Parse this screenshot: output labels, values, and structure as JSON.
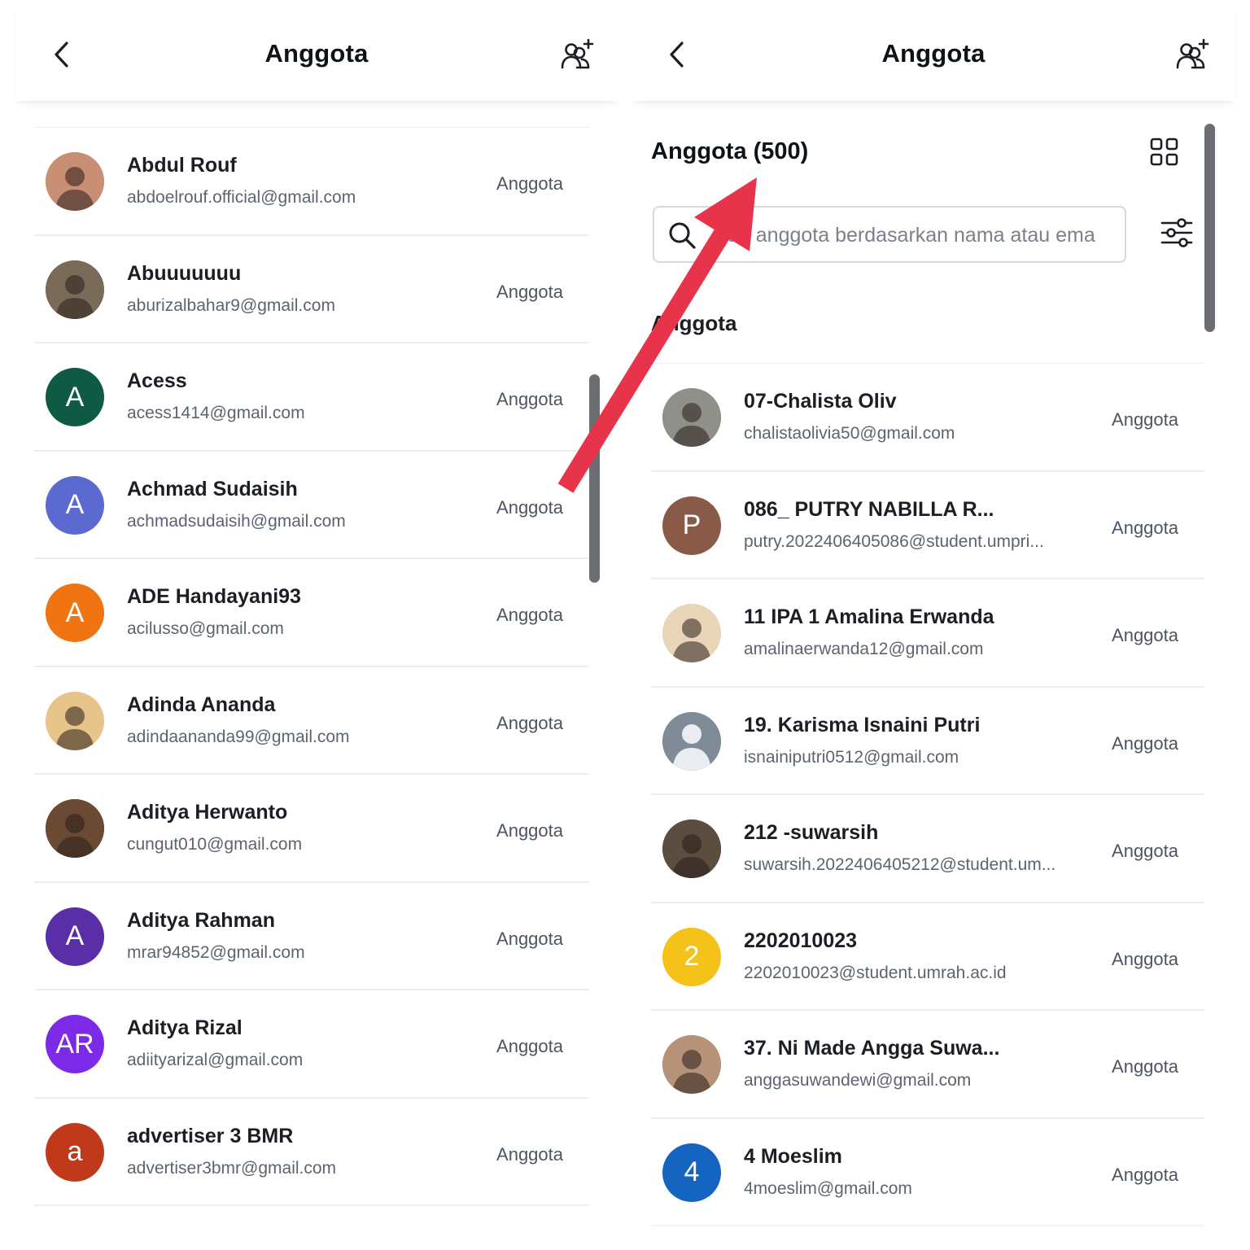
{
  "left": {
    "title": "Anggota",
    "members": [
      {
        "name": "Abdul Rouf",
        "email": "abdoelrouf.official@gmail.com",
        "role": "Anggota",
        "avatar": {
          "type": "photo",
          "color": "#c98f75"
        }
      },
      {
        "name": "Abuuuuuuu",
        "email": "aburizalbahar9@gmail.com",
        "role": "Anggota",
        "avatar": {
          "type": "photo",
          "color": "#7a6a58"
        }
      },
      {
        "name": "Acess",
        "email": "acess1414@gmail.com",
        "role": "Anggota",
        "avatar": {
          "type": "letter",
          "letter": "A",
          "color": "#0f5a45"
        }
      },
      {
        "name": "Achmad Sudaisih",
        "email": "achmadsudaisih@gmail.com",
        "role": "Anggota",
        "avatar": {
          "type": "letter",
          "letter": "A",
          "color": "#5c6ad0"
        }
      },
      {
        "name": "ADE Handayani93",
        "email": "acilusso@gmail.com",
        "role": "Anggota",
        "avatar": {
          "type": "letter",
          "letter": "A",
          "color": "#f07412"
        }
      },
      {
        "name": "Adinda Ananda",
        "email": "adindaananda99@gmail.com",
        "role": "Anggota",
        "avatar": {
          "type": "photo",
          "color": "#e7c48a"
        }
      },
      {
        "name": "Aditya Herwanto",
        "email": "cungut010@gmail.com",
        "role": "Anggota",
        "avatar": {
          "type": "photo",
          "color": "#6b4a34"
        }
      },
      {
        "name": "Aditya Rahman",
        "email": "mrar94852@gmail.com",
        "role": "Anggota",
        "avatar": {
          "type": "letter",
          "letter": "A",
          "color": "#5a2ea6"
        }
      },
      {
        "name": "Aditya Rizal",
        "email": "adiityarizal@gmail.com",
        "role": "Anggota",
        "avatar": {
          "type": "letter",
          "letter": "AR",
          "color": "#7d2ae8"
        }
      },
      {
        "name": "advertiser 3 BMR",
        "email": "advertiser3bmr@gmail.com",
        "role": "Anggota",
        "avatar": {
          "type": "letter",
          "letter": "a",
          "color": "#c0391b"
        }
      }
    ]
  },
  "right": {
    "title": "Anggota",
    "section_title": "Anggota (500)",
    "search_placeholder": "Cari anggota berdasarkan nama atau ema",
    "group_label": "Anggota",
    "members": [
      {
        "name": "07-Chalista Oliv",
        "email": "chalistaolivia50@gmail.com",
        "role": "Anggota",
        "avatar": {
          "type": "photo",
          "color": "#8f9089"
        }
      },
      {
        "name": "086_ PUTRY NABILLA R...",
        "email": "putry.2022406405086@student.umpri...",
        "role": "Anggota",
        "avatar": {
          "type": "letter",
          "letter": "P",
          "color": "#8a5a48"
        }
      },
      {
        "name": "11 IPA 1 Amalina Erwanda",
        "email": "amalinaerwanda12@gmail.com",
        "role": "Anggota",
        "avatar": {
          "type": "photo",
          "color": "#e9d6b8"
        }
      },
      {
        "name": "19. Karisma Isnaini Putri",
        "email": "isnainiputri0512@gmail.com",
        "role": "Anggota",
        "avatar": {
          "type": "default",
          "color": "#7f8c98"
        }
      },
      {
        "name": "212 -suwarsih",
        "email": "suwarsih.2022406405212@student.um...",
        "role": "Anggota",
        "avatar": {
          "type": "photo",
          "color": "#5b4d3f"
        }
      },
      {
        "name": "2202010023",
        "email": "2202010023@student.umrah.ac.id",
        "role": "Anggota",
        "avatar": {
          "type": "letter",
          "letter": "2",
          "color": "#f5c21a"
        }
      },
      {
        "name": "37. Ni Made Angga Suwa...",
        "email": "anggasuwandewi@gmail.com",
        "role": "Anggota",
        "avatar": {
          "type": "photo",
          "color": "#b59278"
        }
      },
      {
        "name": "4 Moeslim",
        "email": "4moeslim@gmail.com",
        "role": "Anggota",
        "avatar": {
          "type": "letter",
          "letter": "4",
          "color": "#1565c0"
        }
      }
    ]
  },
  "colors": {
    "arrow": "#e8344a",
    "divider": "#eceef0",
    "scrollbar": "#6b6f74"
  }
}
